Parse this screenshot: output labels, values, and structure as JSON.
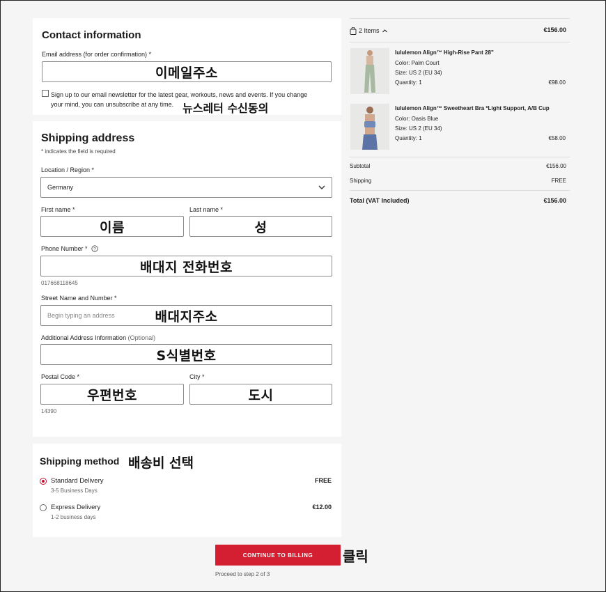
{
  "contact": {
    "title": "Contact information",
    "email_label": "Email address (for order confirmation) *",
    "email_annotation": "이메일주소",
    "newsletter_text_1": "Sign up to our email newsletter for the latest gear, workouts, news and events. If you change",
    "newsletter_text_2": "your mind, you can unsubscribe at any time.",
    "newsletter_annotation": "뉴스레터 수신동의"
  },
  "shipping": {
    "title": "Shipping address",
    "required_note": "* indicates the field is required",
    "location_label": "Location / Region *",
    "location_value": "Germany",
    "first_name_label": "First name *",
    "first_name_annotation": "이름",
    "last_name_label": "Last name *",
    "last_name_annotation": "성",
    "phone_label": "Phone Number *",
    "phone_annotation": "배대지 전화번호",
    "phone_hint": "017668118645",
    "street_label": "Street Name and Number *",
    "street_placeholder": "Begin typing an address",
    "street_annotation": "배대지주소",
    "additional_label": "Additional Address Information",
    "additional_optional": "(Optional)",
    "additional_annotation": "S식별번호",
    "postal_label": "Postal Code *",
    "postal_annotation": "우편번호",
    "postal_hint": "14390",
    "city_label": "City *",
    "city_annotation": "도시"
  },
  "method": {
    "title": "Shipping method",
    "annotation": "배송비 선택",
    "options": [
      {
        "name": "Standard Delivery",
        "detail": "3-5 Business Days",
        "price": "FREE",
        "selected": true
      },
      {
        "name": "Express Delivery",
        "detail": "1-2 business days",
        "price": "€12.00",
        "selected": false
      }
    ]
  },
  "cta": {
    "button_label": "CONTINUE TO BILLING",
    "annotation": "클릭",
    "sub_text": "Proceed to step 2 of 3"
  },
  "summary": {
    "items_label": "2 Items",
    "items_total": "€156.00",
    "products": [
      {
        "name": "lululemon Align™ High-Rise Pant 28\"",
        "color": "Color: Palm Court",
        "size": "Size: US 2 (EU 34)",
        "quantity": "Quantity: 1",
        "price": "€98.00",
        "swatch": "#a7b9a1"
      },
      {
        "name": "lululemon Align™ Sweetheart Bra *Light Support, A/B Cup",
        "color": "Color: Oasis Blue",
        "size": "Size: US 2 (EU 34)",
        "quantity": "Quantity: 1",
        "price": "€58.00",
        "swatch": "#7089b8"
      }
    ],
    "subtotal_label": "Subtotal",
    "subtotal_value": "€156.00",
    "shipping_label": "Shipping",
    "shipping_value": "FREE",
    "total_label": "Total (VAT Included)",
    "total_value": "€156.00"
  },
  "colors": {
    "accent": "#d41f32",
    "radio": "#c8102e"
  },
  "icons": {
    "bag": "shopping-bag-icon",
    "chevron_up": "chevron-up-icon",
    "chevron_down": "chevron-down-icon",
    "help": "help-circle-icon"
  }
}
